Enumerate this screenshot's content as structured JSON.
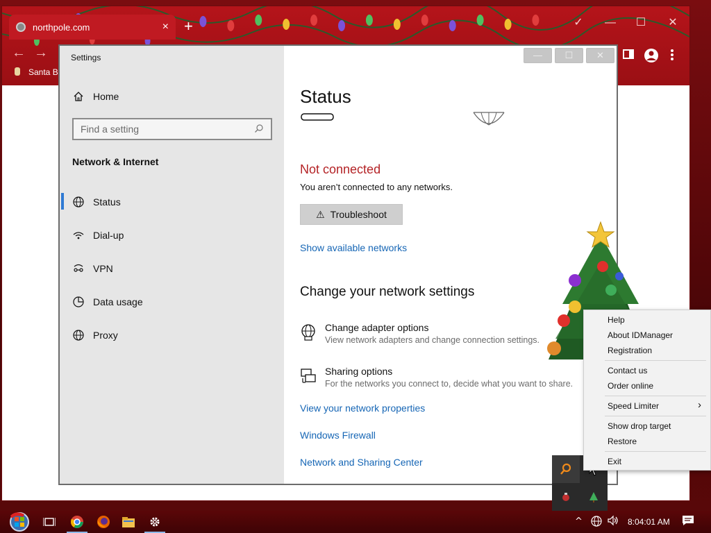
{
  "browser": {
    "tab_title": "northpole.com",
    "tab_close": "×",
    "new_tab": "+",
    "bookmark_label": "Santa Bo",
    "controls": {
      "check": "✓",
      "minimize": "—",
      "maximize": "☐",
      "close": "✕"
    },
    "nav": {
      "back": "←",
      "forward": "→"
    }
  },
  "settings": {
    "window_title": "Settings",
    "title_buttons": {
      "minimize": "—",
      "maximize": "☐",
      "close": "✕"
    },
    "sidebar": {
      "home": "Home",
      "search_placeholder": "Find a setting",
      "section": "Network & Internet",
      "items": [
        {
          "label": "Status",
          "icon": "globe-network-icon"
        },
        {
          "label": "Dial-up",
          "icon": "dialup-icon"
        },
        {
          "label": "VPN",
          "icon": "vpn-icon"
        },
        {
          "label": "Data usage",
          "icon": "data-usage-icon"
        },
        {
          "label": "Proxy",
          "icon": "globe-icon"
        }
      ]
    },
    "main": {
      "title": "Status",
      "state": "Not connected",
      "state_desc": "You aren’t connected to any networks.",
      "troubleshoot": "Troubleshoot",
      "show_networks": "Show available networks",
      "change_heading": "Change your network settings",
      "options": [
        {
          "title": "Change adapter options",
          "desc": "View network adapters and change connection settings."
        },
        {
          "title": "Sharing options",
          "desc": "For the networks you connect to, decide what you want to share."
        }
      ],
      "links": [
        "View your network properties",
        "Windows Firewall",
        "Network and Sharing Center"
      ]
    }
  },
  "context_menu": {
    "items": [
      "Help",
      "About IDManager",
      "Registration",
      "Contact us",
      "Order online",
      "Speed Limiter",
      "Show drop target",
      "Restore",
      "Exit"
    ],
    "submenu_arrow": "›"
  },
  "taskbar": {
    "clock": "8:04:01 AM",
    "tray_up": "^",
    "notification_icon": "▭"
  },
  "colors": {
    "accent": "#1666b5",
    "error": "#b42326",
    "browser_red": "#b5141a",
    "active_indicator": "#2f7ad4"
  }
}
